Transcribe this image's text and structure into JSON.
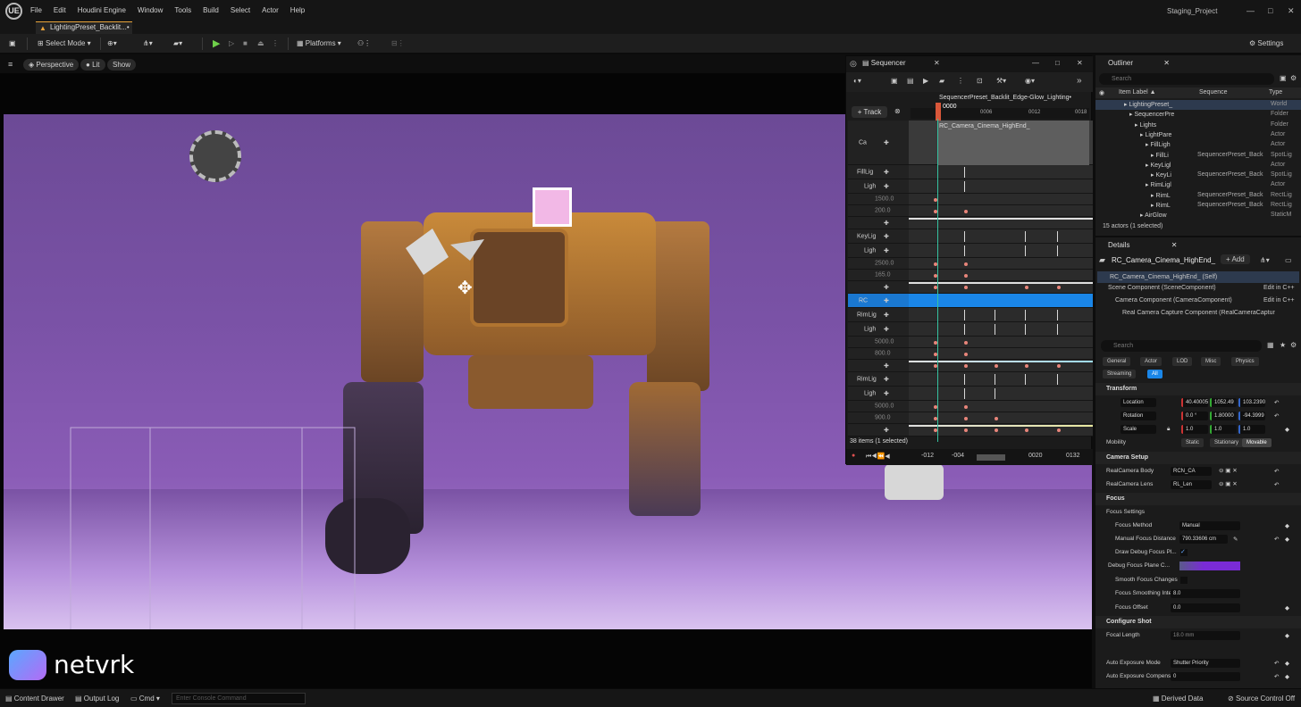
{
  "app": {
    "logo": "UE",
    "project": "Staging_Project",
    "controls": [
      "—",
      "□",
      "✕"
    ]
  },
  "menu": [
    "File",
    "Edit",
    "Houdini Engine",
    "Window",
    "Tools",
    "Build",
    "Select",
    "Actor",
    "Help"
  ],
  "level_tab": "LightingPreset_Backlit...•",
  "toolbar": {
    "select_mode": "Select Mode",
    "platforms": "Platforms",
    "settings": "Settings"
  },
  "viewport": {
    "perspective": "Perspective",
    "lit": "Lit",
    "show": "Show"
  },
  "watermark": "netvrk",
  "sequencer": {
    "tab": "Sequencer",
    "sequence_name": "SequencerPreset_Backlit_Edge-Glow_Lighting•",
    "frame": "0000",
    "track_button": "Track",
    "ruler": [
      "0006",
      "0012",
      "0018"
    ],
    "camera_section": "RC_Camera_Cinema_HighEnd_",
    "tracks": [
      {
        "label": "Ca",
        "type": "camera"
      },
      {
        "label": "FillLig",
        "type": "group"
      },
      {
        "label": "Ligh",
        "type": "sub"
      },
      {
        "label": "1500.0",
        "type": "value"
      },
      {
        "label": "200.0",
        "type": "value"
      },
      {
        "label": "",
        "type": "add"
      },
      {
        "label": "KeyLig",
        "type": "group"
      },
      {
        "label": "Ligh",
        "type": "sub"
      },
      {
        "label": "2500.0",
        "type": "value"
      },
      {
        "label": "165.0",
        "type": "value"
      },
      {
        "label": "",
        "type": "add"
      },
      {
        "label": "RC",
        "type": "selected"
      },
      {
        "label": "RimLig",
        "type": "group"
      },
      {
        "label": "Ligh",
        "type": "sub"
      },
      {
        "label": "5000.0",
        "type": "value"
      },
      {
        "label": "800.0",
        "type": "value"
      },
      {
        "label": "",
        "type": "add"
      },
      {
        "label": "RimLig",
        "type": "group"
      },
      {
        "label": "Ligh",
        "type": "sub"
      },
      {
        "label": "5000.0",
        "type": "value"
      },
      {
        "label": "900.0",
        "type": "value"
      },
      {
        "label": "",
        "type": "add"
      }
    ],
    "status": "38 items (1 selected)",
    "transport": {
      "start": "-012",
      "mid": "-004",
      "end_a": "0020",
      "end_b": "0132"
    }
  },
  "outliner": {
    "tab": "Outliner",
    "search_placeholder": "Search",
    "columns": {
      "label": "Item Label ▲",
      "sequence": "Sequence",
      "type": "Type"
    },
    "rows": [
      {
        "label": "LightingPreset_",
        "sequence": "",
        "type": "World",
        "indent": 1,
        "selected": true
      },
      {
        "label": "SequencerPre",
        "sequence": "",
        "type": "Folder",
        "indent": 2
      },
      {
        "label": "Lights",
        "sequence": "",
        "type": "Folder",
        "indent": 3
      },
      {
        "label": "LightPare",
        "sequence": "",
        "type": "Actor",
        "indent": 4
      },
      {
        "label": "FillLigh",
        "sequence": "",
        "type": "Actor",
        "indent": 5
      },
      {
        "label": "FillLi",
        "sequence": "SequencerPreset_Back",
        "type": "SpotLig",
        "indent": 6
      },
      {
        "label": "KeyLigl",
        "sequence": "",
        "type": "Actor",
        "indent": 5
      },
      {
        "label": "KeyLi",
        "sequence": "SequencerPreset_Back",
        "type": "SpotLig",
        "indent": 6
      },
      {
        "label": "RimLigl",
        "sequence": "",
        "type": "Actor",
        "indent": 5
      },
      {
        "label": "RimL",
        "sequence": "SequencerPreset_Back",
        "type": "RectLig",
        "indent": 6
      },
      {
        "label": "RimL",
        "sequence": "SequencerPreset_Back",
        "type": "RectLig",
        "indent": 6
      },
      {
        "label": "AirGlow",
        "sequence": "",
        "type": "StaticM",
        "indent": 4
      }
    ],
    "count": "15 actors (1 selected)"
  },
  "details": {
    "tab": "Details",
    "actor": "RC_Camera_Cinema_HighEnd_",
    "add": "Add",
    "self": "RC_Camera_Cinema_HighEnd_ (Self)",
    "components": [
      {
        "name": "Scene Component (SceneComponent)",
        "edit": "Edit in C++"
      },
      {
        "name": "Camera Component (CameraComponent)",
        "edit": "Edit in C++"
      },
      {
        "name": "Real Camera Capture Component (RealCameraCaptur",
        "edit": ""
      }
    ],
    "search_placeholder": "Search",
    "filters": [
      "General",
      "Actor",
      "LOD",
      "Misc",
      "Physics",
      "Streaming",
      "All"
    ],
    "transform": {
      "title": "Transform",
      "location": {
        "label": "Location",
        "values": [
          "40.40005",
          "1052.49",
          "103.2390"
        ]
      },
      "rotation": {
        "label": "Rotation",
        "values": [
          "0.0 °",
          "1.80000",
          "-94.3999"
        ]
      },
      "scale": {
        "label": "Scale",
        "values": [
          "1.0",
          "1.0",
          "1.0"
        ]
      },
      "mobility": {
        "label": "Mobility",
        "options": [
          "Static",
          "Stationary",
          "Movable"
        ]
      }
    },
    "camera_setup": {
      "title": "Camera Setup",
      "body_label": "RealCamera Body",
      "body_value": "RCN_CA",
      "lens_label": "RealCamera Lens",
      "lens_value": "RL_Len"
    },
    "focus": {
      "title": "Focus",
      "settings": "Focus Settings",
      "method_label": "Focus Method",
      "method_value": "Manual",
      "distance_label": "Manual Focus Distance",
      "distance_value": "790.33606 cm",
      "debug_plane_label": "Draw Debug Focus Pl...",
      "debug_color_label": "Debug Focus Plane C...",
      "debug_color": "#7a2bd6",
      "smooth_label": "Smooth Focus Changes",
      "smoothing_label": "Focus Smoothing Inte...",
      "smoothing_value": "8.0",
      "offset_label": "Focus Offset",
      "offset_value": "0.0"
    },
    "configure_shot": {
      "title": "Configure Shot",
      "focal_label": "Focal Length",
      "focal_value": "18.0 mm",
      "exposure_label": "Auto Exposure Mode",
      "exposure_value": "Shutter Priority",
      "comp_label": "Auto Exposure Compensa...",
      "comp_value": "0"
    }
  },
  "statusbar": {
    "content_drawer": "Content Drawer",
    "output_log": "Output Log",
    "cmd": "Cmd",
    "console_placeholder": "Enter Console Command",
    "derived_data": "Derived Data",
    "source_control": "Source Control Off"
  }
}
